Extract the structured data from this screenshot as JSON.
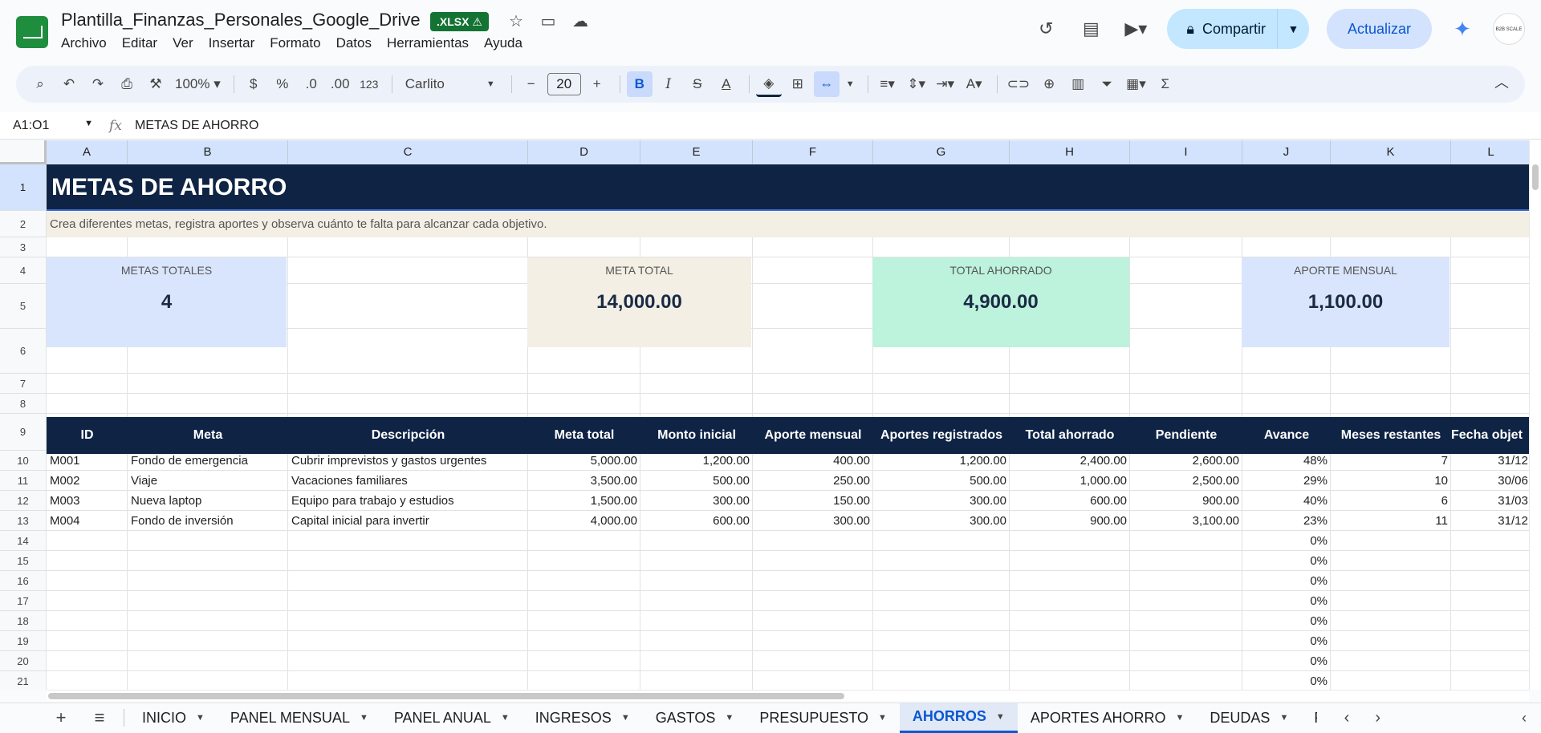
{
  "doc": {
    "title": "Plantilla_Finanzas_Personales_Google_Drive",
    "badge": ".XLSX ⚠"
  },
  "menus": [
    "Archivo",
    "Editar",
    "Ver",
    "Insertar",
    "Formato",
    "Datos",
    "Herramientas",
    "Ayuda"
  ],
  "header": {
    "share_label": "Compartir",
    "update_label": "Actualizar",
    "avatar_text": "B2B SCALE"
  },
  "toolbar": {
    "zoom": "100%",
    "currency": "$",
    "percent": "%",
    "dec_decrease": ".0",
    "dec_increase": ".00",
    "number_format": "123",
    "font": "Carlito",
    "font_size": "20",
    "bold": "B",
    "italic": "I",
    "text_color": "A"
  },
  "formula_bar": {
    "name_box": "A1:O1",
    "fx": "fx",
    "value": "METAS DE AHORRO"
  },
  "columns": [
    "A",
    "B",
    "C",
    "D",
    "E",
    "F",
    "G",
    "H",
    "I",
    "J",
    "K",
    "L"
  ],
  "rows": [
    "1",
    "2",
    "3",
    "4",
    "5",
    "6",
    "7",
    "8",
    "9",
    "10",
    "11",
    "12",
    "13",
    "14",
    "15",
    "16",
    "17",
    "18",
    "19",
    "20",
    "21"
  ],
  "sheet": {
    "title": "METAS DE AHORRO",
    "subtitle": "Crea diferentes metas, registra aportes y observa cuánto te falta para alcanzar cada objetivo.",
    "kpis": {
      "metas_totales": {
        "label": "METAS TOTALES",
        "value": "4"
      },
      "meta_total": {
        "label": "META TOTAL",
        "value": "14,000.00"
      },
      "total_ahorrado": {
        "label": "TOTAL AHORRADO",
        "value": "4,900.00"
      },
      "aporte_mensual": {
        "label": "APORTE MENSUAL",
        "value": "1,100.00"
      }
    },
    "headers": [
      "ID",
      "Meta",
      "Descripción",
      "Meta total",
      "Monto inicial",
      "Aporte mensual",
      "Aportes registrados",
      "Total ahorrado",
      "Pendiente",
      "Avance",
      "Meses restantes",
      "Fecha objet"
    ],
    "data_rows": [
      [
        "M001",
        "Fondo de emergencia",
        "Cubrir imprevistos y gastos urgentes",
        "5,000.00",
        "1,200.00",
        "400.00",
        "1,200.00",
        "2,400.00",
        "2,600.00",
        "48%",
        "7",
        "31/12,"
      ],
      [
        "M002",
        "Viaje",
        "Vacaciones familiares",
        "3,500.00",
        "500.00",
        "250.00",
        "500.00",
        "1,000.00",
        "2,500.00",
        "29%",
        "10",
        "30/06,"
      ],
      [
        "M003",
        "Nueva laptop",
        "Equipo para trabajo y estudios",
        "1,500.00",
        "300.00",
        "150.00",
        "300.00",
        "600.00",
        "900.00",
        "40%",
        "6",
        "31/03,"
      ],
      [
        "M004",
        "Fondo de inversión",
        "Capital inicial para invertir",
        "4,000.00",
        "600.00",
        "300.00",
        "300.00",
        "900.00",
        "3,100.00",
        "23%",
        "11",
        "31/12,"
      ]
    ],
    "empty_avance": [
      "0%",
      "0%",
      "0%",
      "0%",
      "0%",
      "0%",
      "0%",
      "0%"
    ]
  },
  "tabs": [
    {
      "label": "INICIO",
      "active": false
    },
    {
      "label": "PANEL MENSUAL",
      "active": false
    },
    {
      "label": "PANEL ANUAL",
      "active": false
    },
    {
      "label": "INGRESOS",
      "active": false
    },
    {
      "label": "GASTOS",
      "active": false
    },
    {
      "label": "PRESUPUESTO",
      "active": false
    },
    {
      "label": "AHORROS",
      "active": true
    },
    {
      "label": "APORTES AHORRO",
      "active": false
    },
    {
      "label": "DEUDAS",
      "active": false
    },
    {
      "label": "PA",
      "active": false
    }
  ],
  "colors": {
    "header_navy": "#0f2444",
    "kpi_blue": "#d9e5fd",
    "kpi_beige": "#f3efe5",
    "kpi_green": "#bdf2dd",
    "accent": "#0b57d0",
    "share_bg": "#c2e7ff"
  }
}
